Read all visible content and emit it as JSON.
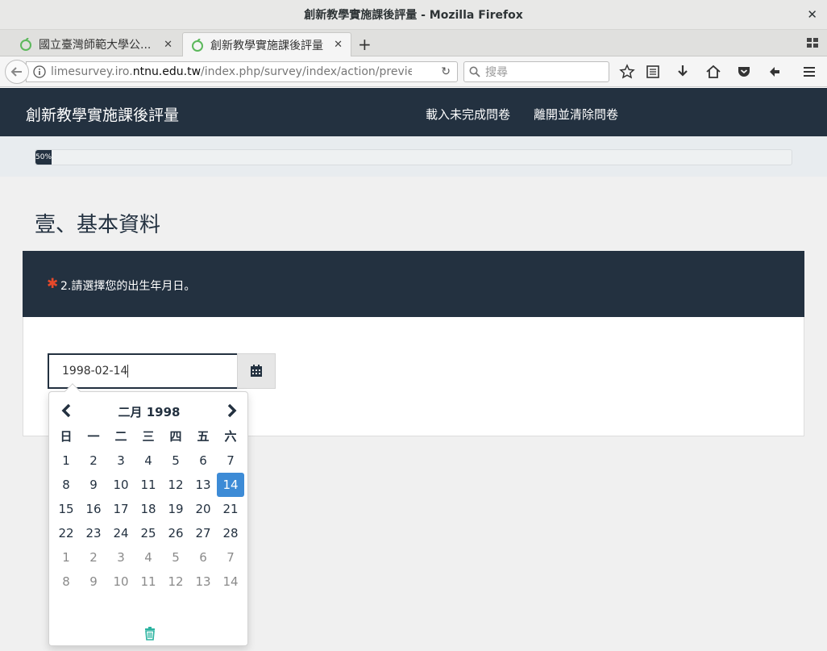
{
  "window": {
    "title": "創新教學實施課後評量 - Mozilla Firefox",
    "close_glyph": "✕"
  },
  "tabs": [
    {
      "label": "國立臺灣師範大學公...",
      "close": "✕"
    },
    {
      "label": "創新教學實施課後評量",
      "close": "✕"
    }
  ],
  "newtab_glyph": "+",
  "urlbar": {
    "url_prefix": "limesurvey.iro.",
    "url_domain": "ntnu.edu.tw",
    "url_suffix": "/index.php/survey/index/action/previewque",
    "reload_glyph": "↻"
  },
  "search": {
    "placeholder": "搜尋"
  },
  "survey": {
    "brand": "創新教學實施課後評量",
    "load_link": "載入未完成問卷",
    "exit_link": "離開並清除問卷",
    "progress_percent": 50,
    "progress_label": "50%",
    "group_title": "壹、基本資料",
    "required_mark": "✱",
    "question_text": "2.請選擇您的出生年月日。",
    "answer_value": "1998-02-14"
  },
  "datepicker": {
    "month_label": "二月 1998",
    "weekdays": [
      "日",
      "一",
      "二",
      "三",
      "四",
      "五",
      "六"
    ],
    "weeks": [
      [
        "1",
        "2",
        "3",
        "4",
        "5",
        "6",
        "7"
      ],
      [
        "8",
        "9",
        "10",
        "11",
        "12",
        "13",
        "14"
      ],
      [
        "15",
        "16",
        "17",
        "18",
        "19",
        "20",
        "21"
      ],
      [
        "22",
        "23",
        "24",
        "25",
        "26",
        "27",
        "28"
      ],
      [
        "1",
        "2",
        "3",
        "4",
        "5",
        "6",
        "7"
      ],
      [
        "8",
        "9",
        "10",
        "11",
        "12",
        "13",
        "14"
      ]
    ],
    "selected_day": "14",
    "colors": {
      "selected": "#3d8bd6",
      "text": "#233140",
      "muted": "#8a8a8a",
      "trash": "#2bb3a0"
    }
  },
  "colors": {
    "header_bg": "#233140",
    "required": "#e7492a"
  }
}
